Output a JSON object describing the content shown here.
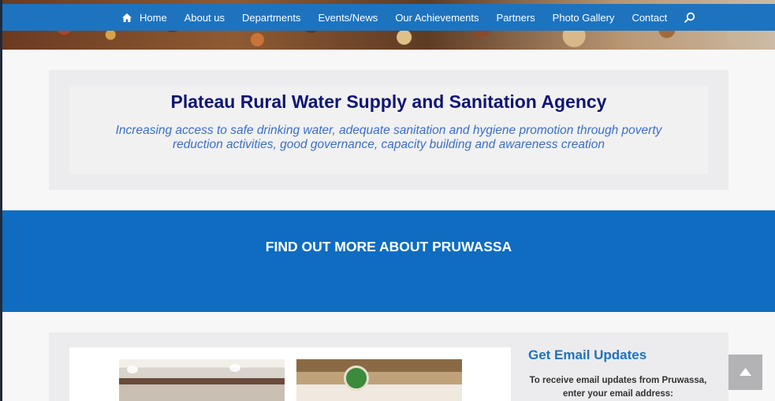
{
  "nav": {
    "items": [
      {
        "label": "Home",
        "icon": "home-icon"
      },
      {
        "label": "About us"
      },
      {
        "label": "Departments"
      },
      {
        "label": "Events/News"
      },
      {
        "label": "Our Achievements"
      },
      {
        "label": "Partners"
      },
      {
        "label": "Photo Gallery"
      },
      {
        "label": "Contact"
      }
    ],
    "search_icon": "search-icon"
  },
  "intro": {
    "title": "Plateau Rural Water Supply and Sanitation Agency",
    "tagline": "Increasing access to safe drinking water, adequate sanitation and hygiene promotion through poverty reduction activities, good governance, capacity building and awareness creation"
  },
  "cta": {
    "label": "FIND OUT MORE ABOUT PRUWASSA"
  },
  "email_widget": {
    "title": "Get Email Updates",
    "description": "To receive email updates from Pruwassa, enter your email address:"
  },
  "colors": {
    "nav_bg": "#1e73be",
    "cta_bg": "#0f6cc0",
    "title_color": "#101573",
    "tagline_color": "#3a6fc4"
  },
  "back_to_top_icon": "chevron-up-icon"
}
